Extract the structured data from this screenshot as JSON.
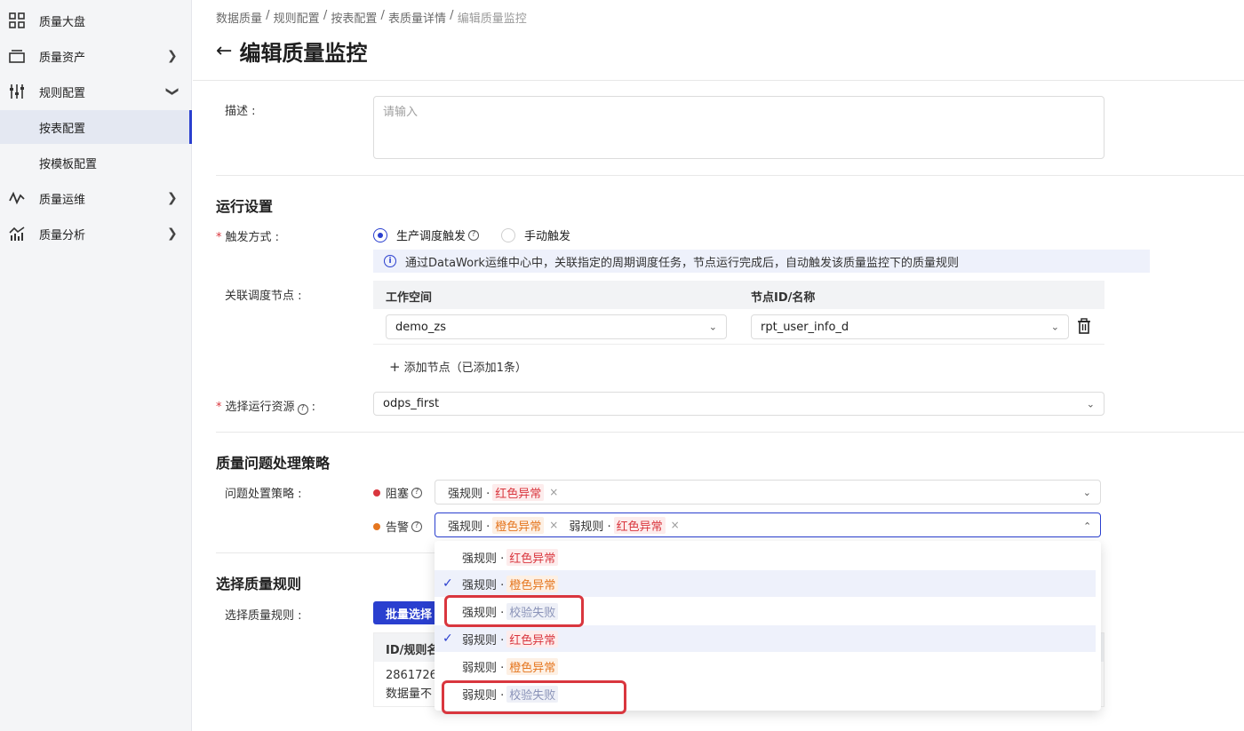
{
  "sidebar": {
    "items": [
      {
        "label": "质量大盘",
        "icon": "dashboard-icon"
      },
      {
        "label": "质量资产",
        "icon": "assets-icon"
      },
      {
        "label": "规则配置",
        "icon": "rules-icon"
      },
      {
        "label": "按表配置"
      },
      {
        "label": "按模板配置"
      },
      {
        "label": "质量运维",
        "icon": "ops-icon"
      },
      {
        "label": "质量分析",
        "icon": "analysis-icon"
      }
    ]
  },
  "breadcrumb": [
    "数据质量",
    "规则配置",
    "按表配置",
    "表质量详情",
    "编辑质量监控"
  ],
  "breadcrumb_sep": " / ",
  "page_title": "编辑质量监控",
  "description": {
    "label": "描述 :",
    "placeholder": "请输入"
  },
  "run_settings": {
    "title": "运行设置",
    "trigger_label": "触发方式 :",
    "trigger_options": [
      "生产调度触发",
      "手动触发"
    ],
    "trigger_selected": "生产调度触发",
    "info": "通过DataWork运维中心中，关联指定的周期调度任务，节点运行完成后，自动触发该质量监控下的质量规则",
    "nodes_label": "关联调度节点 :",
    "columns": [
      "工作空间",
      "节点ID/名称"
    ],
    "workspace": "demo_zs",
    "node": "rpt_user_info_d",
    "add_node": "添加节点（已添加1条）",
    "resource_label": "选择运行资源",
    "resource_value": "odps_first"
  },
  "policy": {
    "title": "质量问题处理策略",
    "label": "问题处置策略 :",
    "block_label": "阻塞",
    "warn_label": "告警",
    "block_tags": [
      {
        "rule": "强规则 ·",
        "level": "红色异常",
        "color": "red"
      }
    ],
    "warn_tags": [
      {
        "rule": "强规则 ·",
        "level": "橙色异常",
        "color": "orange"
      },
      {
        "rule": "弱规则 ·",
        "level": "红色异常",
        "color": "red"
      }
    ],
    "options": [
      {
        "rule": "强规则 ·",
        "level": "红色异常",
        "color": "red",
        "checked": false
      },
      {
        "rule": "强规则 ·",
        "level": "橙色异常",
        "color": "orange",
        "checked": true
      },
      {
        "rule": "强规则 ·",
        "level": "校验失败",
        "color": "gray",
        "checked": false
      },
      {
        "rule": "弱规则 ·",
        "level": "红色异常",
        "color": "red",
        "checked": true
      },
      {
        "rule": "弱规则 ·",
        "level": "橙色异常",
        "color": "orange",
        "checked": false
      },
      {
        "rule": "弱规则 ·",
        "level": "校验失败",
        "color": "gray",
        "checked": false
      }
    ]
  },
  "rules": {
    "title": "选择质量规则",
    "label": "选择质量规则 :",
    "batch_button": "批量选择",
    "column": "ID/规则名",
    "row_id": "28617261",
    "row_name": "数据量不"
  },
  "colors": {
    "primary": "#2a3fcf",
    "red": "#d9363e",
    "orange": "#e5761f"
  }
}
